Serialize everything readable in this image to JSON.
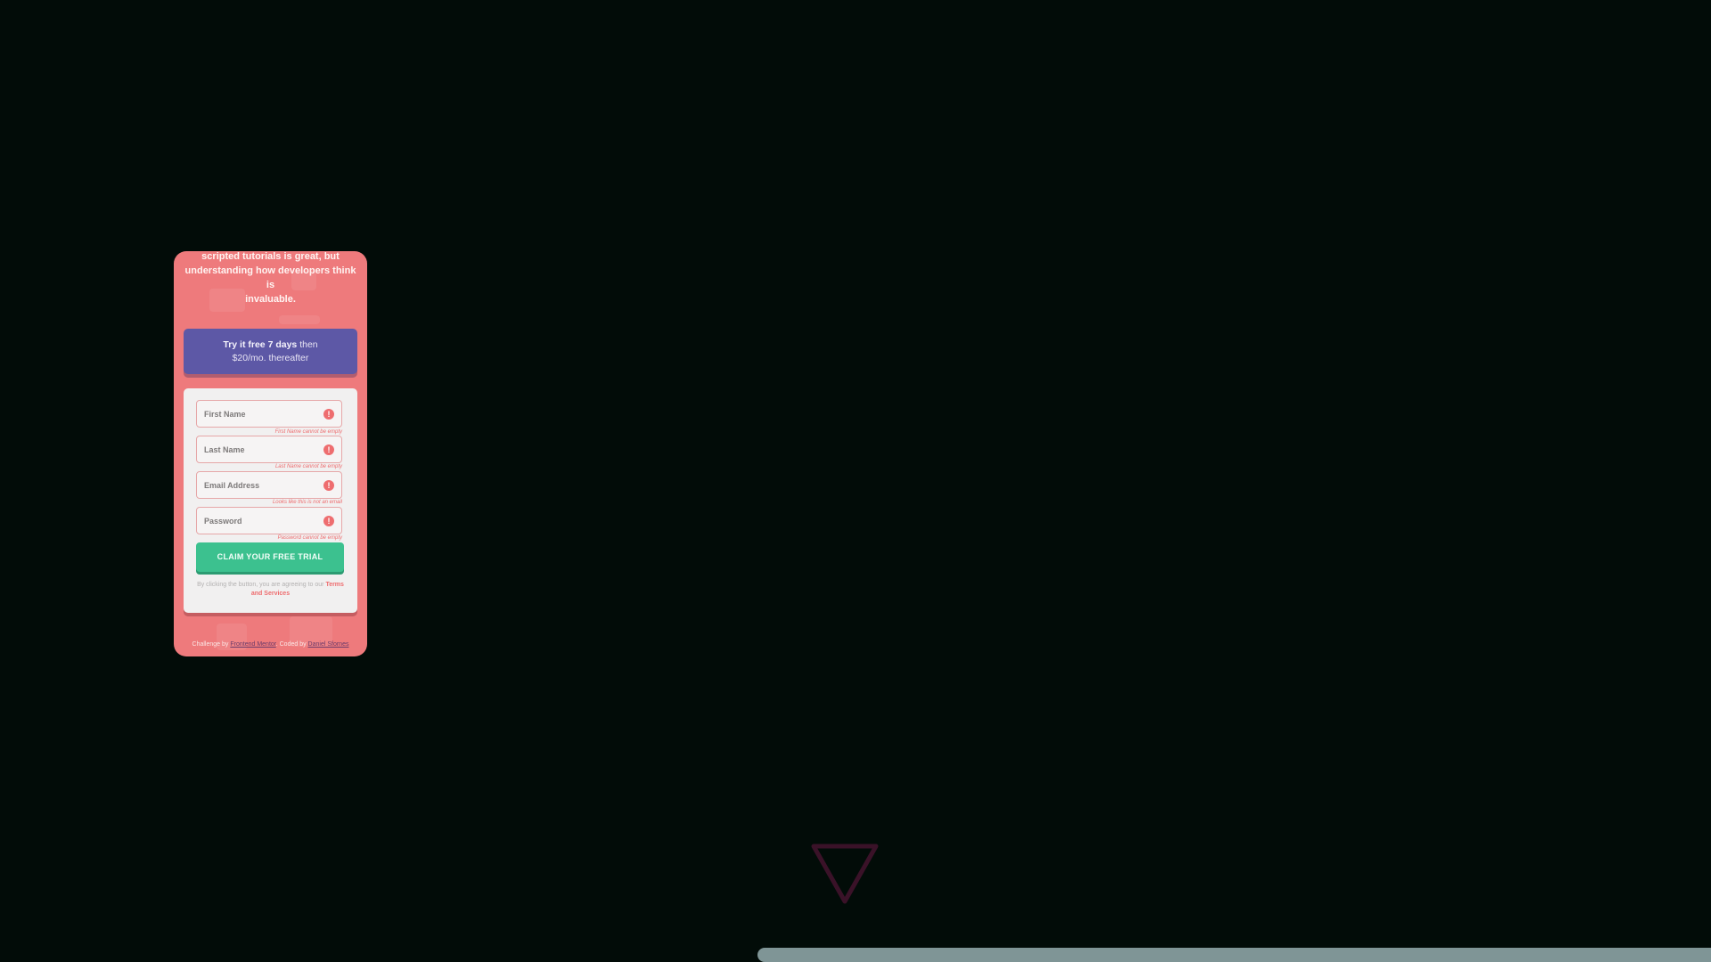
{
  "hero": {
    "line1": "scripted tutorials is great, but",
    "line2": "understanding how developers think is",
    "line3": "invaluable."
  },
  "promo": {
    "bold": "Try it free 7 days",
    "rest1": "then",
    "rest2": "$20/mo. thereafter"
  },
  "form": {
    "first_name_placeholder": "First Name",
    "first_name_error": "First Name cannot be empty",
    "last_name_placeholder": "Last Name",
    "last_name_error": "Last Name cannot be empty",
    "email_placeholder": "Email Address",
    "email_error": "Looks like this is not an email",
    "password_placeholder": "Password",
    "password_error": "Password cannot be empty",
    "error_icon": "!",
    "submit_label": "CLAIM YOUR FREE TRIAL",
    "terms_prefix": "By clicking the button, you are agreeing to our",
    "terms_link": "Terms and Services"
  },
  "footer": {
    "challenge_prefix": "Challenge by",
    "challenge_link": "Frontend Mentor",
    "coded_prefix": ". Coded by",
    "coded_link": "Daniel Sfornes"
  },
  "colors": {
    "page_bg": "#020c08",
    "card_bg": "#ee7a7c",
    "promo_bg": "#5d58a6",
    "cta_bg": "#3cc18f",
    "error": "#ee6d6f",
    "scrollbar": "#7f9596"
  },
  "icons": {
    "error": "exclamation-circle-icon",
    "overlay": "triangle-down-icon"
  }
}
